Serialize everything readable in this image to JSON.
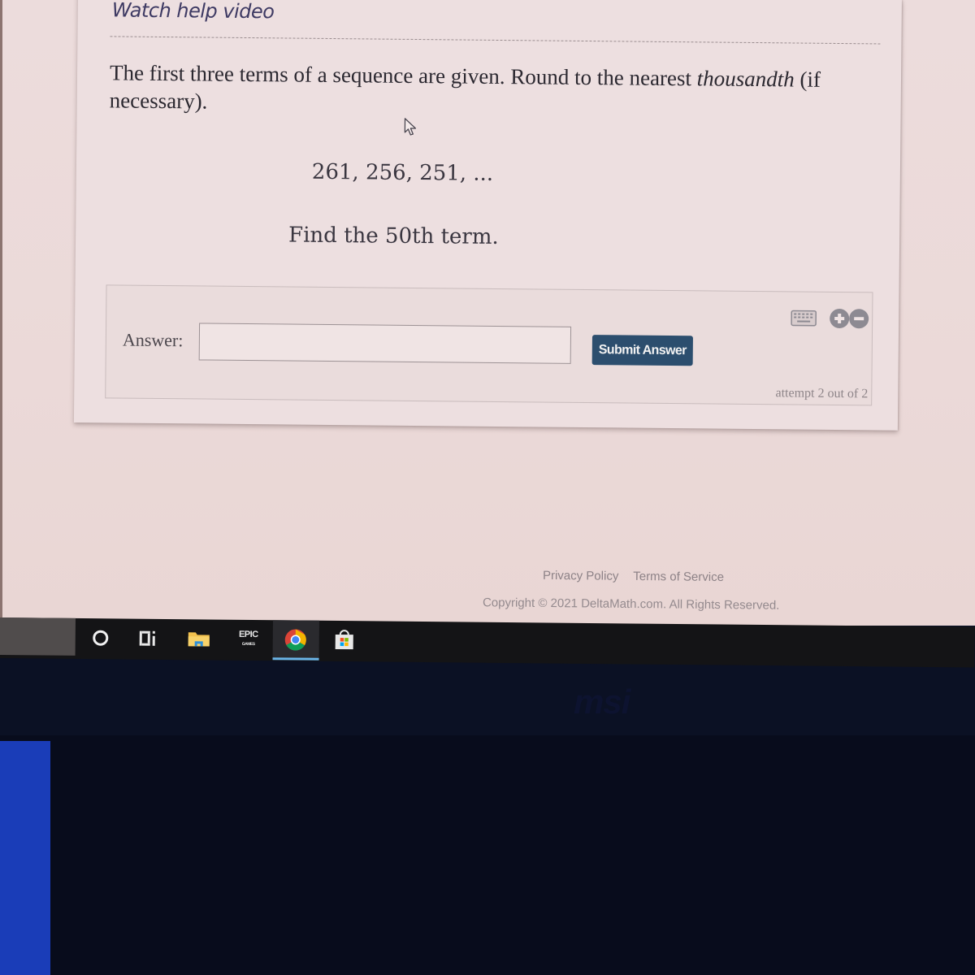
{
  "page": {
    "help_link": "Watch help video",
    "question_prefix": "The first three terms of a sequence are given. Round to the nearest ",
    "question_emphasis": "thousandth",
    "question_suffix": " (if necessary).",
    "sequence": "261, 256, 251, ...",
    "sequence_terms": [
      261,
      256,
      251
    ],
    "prompt": "Find the 50th term."
  },
  "answer_panel": {
    "label": "Answer:",
    "input_value": "",
    "input_placeholder": "",
    "submit_label": "Submit Answer",
    "attempt_text": "attempt 2 out of 2",
    "icons": [
      "keyboard-icon",
      "zoom-in-icon",
      "zoom-out-icon"
    ]
  },
  "footer": {
    "privacy_policy": "Privacy Policy",
    "terms_of_service": "Terms of Service",
    "copyright": "Copyright © 2021 DeltaMath.com. All Rights Reserved."
  },
  "taskbar": {
    "icons": [
      "cortana-icon",
      "task-view-icon",
      "file-explorer-icon",
      "epic-games-icon",
      "chrome-icon",
      "microsoft-store-icon"
    ],
    "active_app": "chrome-icon",
    "epic_label": "EPIC",
    "epic_sublabel": "GAMES"
  },
  "bezel": {
    "logo": "msi"
  },
  "colors": {
    "submit_button": "#2c4e6e",
    "help_link": "#3e3a63",
    "taskbar": "#141416",
    "active_indicator": "#6ab4e6"
  }
}
